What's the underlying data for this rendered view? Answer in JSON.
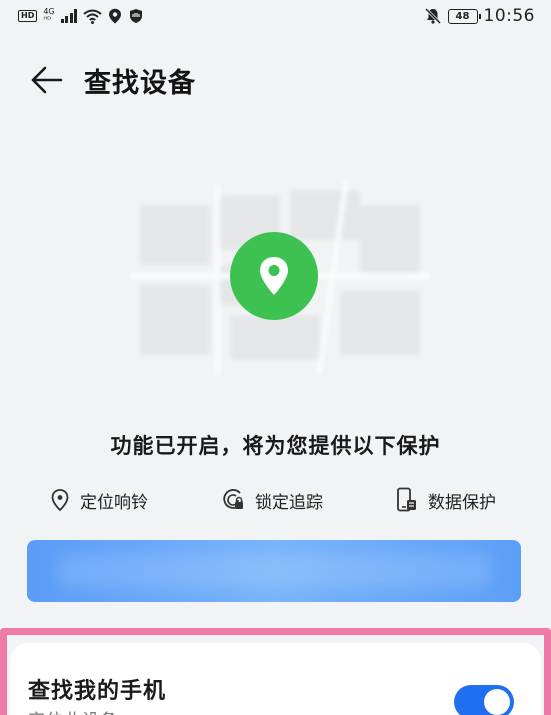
{
  "status_bar": {
    "hd": "HD",
    "network_top": "4G",
    "network_bottom": "ᴴᴰ",
    "battery": "48",
    "time": "10:56",
    "icons": [
      "hd-icon",
      "signal-icon",
      "wifi-icon",
      "location-icon",
      "shield-icon",
      "mute-bell-icon",
      "battery-icon"
    ]
  },
  "header": {
    "title": "查找设备",
    "back_icon": "back-arrow-icon"
  },
  "hero": {
    "pin_icon": "location-pin-icon",
    "pin_color": "#3dc251"
  },
  "info": {
    "headline": "功能已开启，将为您提供以下保护",
    "features": [
      {
        "label": "定位响铃",
        "icon": "location-pin-outline-icon"
      },
      {
        "label": "锁定追踪",
        "icon": "lock-track-icon"
      },
      {
        "label": "数据保护",
        "icon": "phone-protect-icon"
      }
    ]
  },
  "action_button": {
    "color": "#5a9cf8"
  },
  "card": {
    "title": "查找我的手机",
    "subtitle": "定位此设备",
    "toggle_on": true,
    "accent": "#1f6ff0",
    "highlight_color": "#f07aa6"
  }
}
